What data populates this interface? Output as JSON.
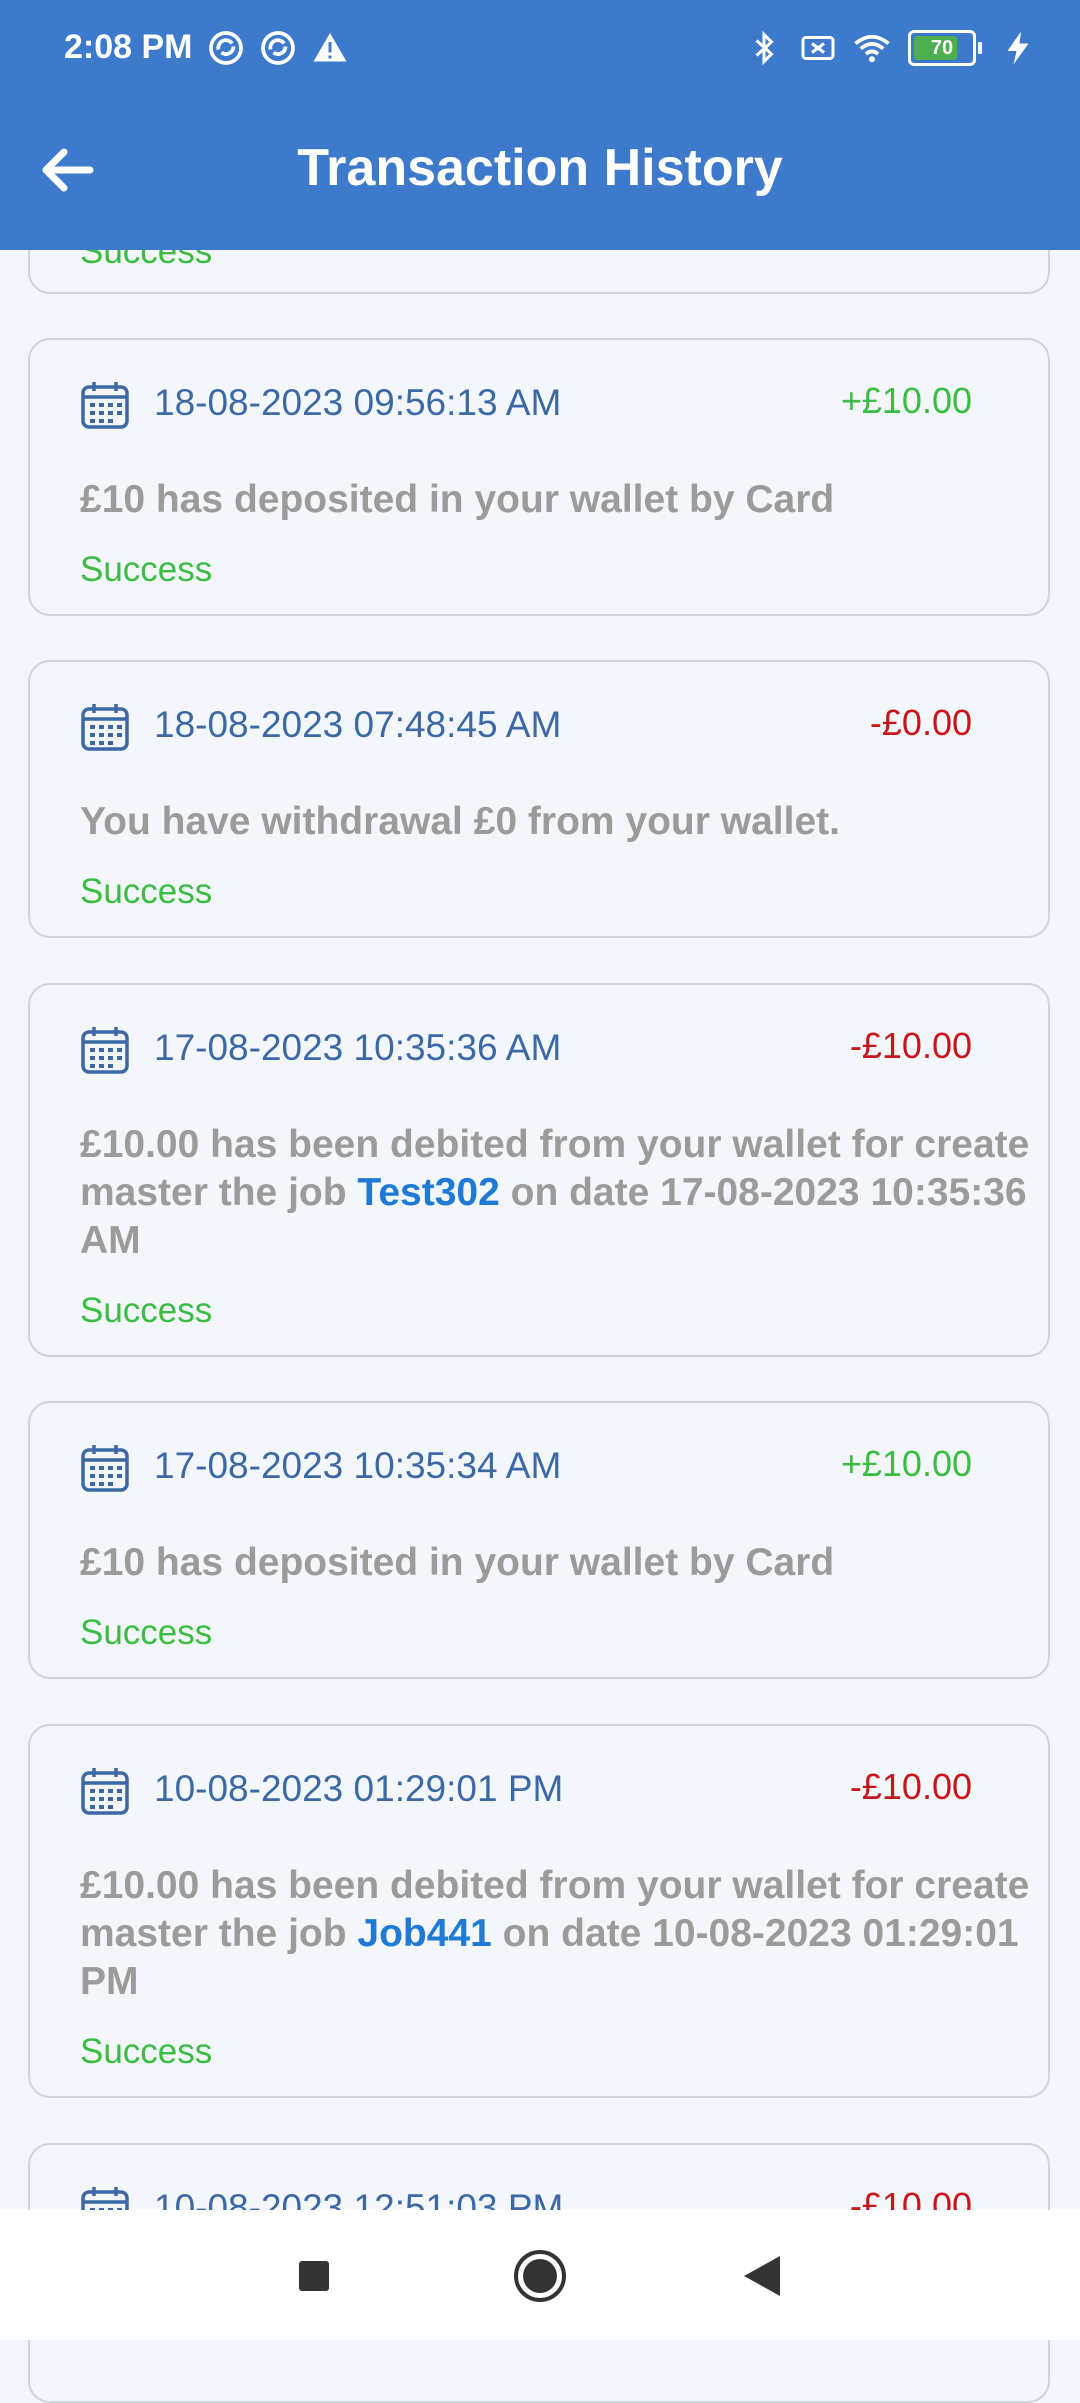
{
  "status_bar": {
    "time": "2:08 PM",
    "battery": "70"
  },
  "header": {
    "title": "Transaction History"
  },
  "partial_top": {
    "status": "Success"
  },
  "transactions": [
    {
      "date": "18-08-2023 09:56:13 AM",
      "amount": "+£10.00",
      "type": "credit",
      "desc_pre": "£10 has deposited in your wallet by Card",
      "job": "",
      "desc_post": "",
      "status": "Success"
    },
    {
      "date": "18-08-2023 07:48:45 AM",
      "amount": "-£0.00",
      "type": "debit",
      "desc_pre": "You have withdrawal £0 from your wallet.",
      "job": "",
      "desc_post": "",
      "status": "Success"
    },
    {
      "date": "17-08-2023 10:35:36 AM",
      "amount": "-£10.00",
      "type": "debit",
      "desc_pre": "£10.00 has been debited from your wallet for create master the job ",
      "job": "Test302",
      "desc_post": " on date 17-08-2023 10:35:36 AM",
      "status": "Success"
    },
    {
      "date": "17-08-2023 10:35:34 AM",
      "amount": "+£10.00",
      "type": "credit",
      "desc_pre": "£10 has deposited in your wallet by Card",
      "job": "",
      "desc_post": "",
      "status": "Success"
    },
    {
      "date": "10-08-2023 01:29:01 PM",
      "amount": "-£10.00",
      "type": "debit",
      "desc_pre": "£10.00 has been debited from your wallet for create master the job ",
      "job": "Job441",
      "desc_post": " on date 10-08-2023 01:29:01 PM",
      "status": "Success"
    },
    {
      "date": "10-08-2023 12:51:03 PM",
      "amount": "-£10.00",
      "type": "debit",
      "desc_pre": "",
      "job": "",
      "desc_post": "",
      "status": ""
    }
  ],
  "colors": {
    "header": "#3d7acb",
    "credit": "#3bbd43",
    "debit": "#c9141c",
    "date": "#3c69a6",
    "job_link": "#1f7ad6"
  }
}
